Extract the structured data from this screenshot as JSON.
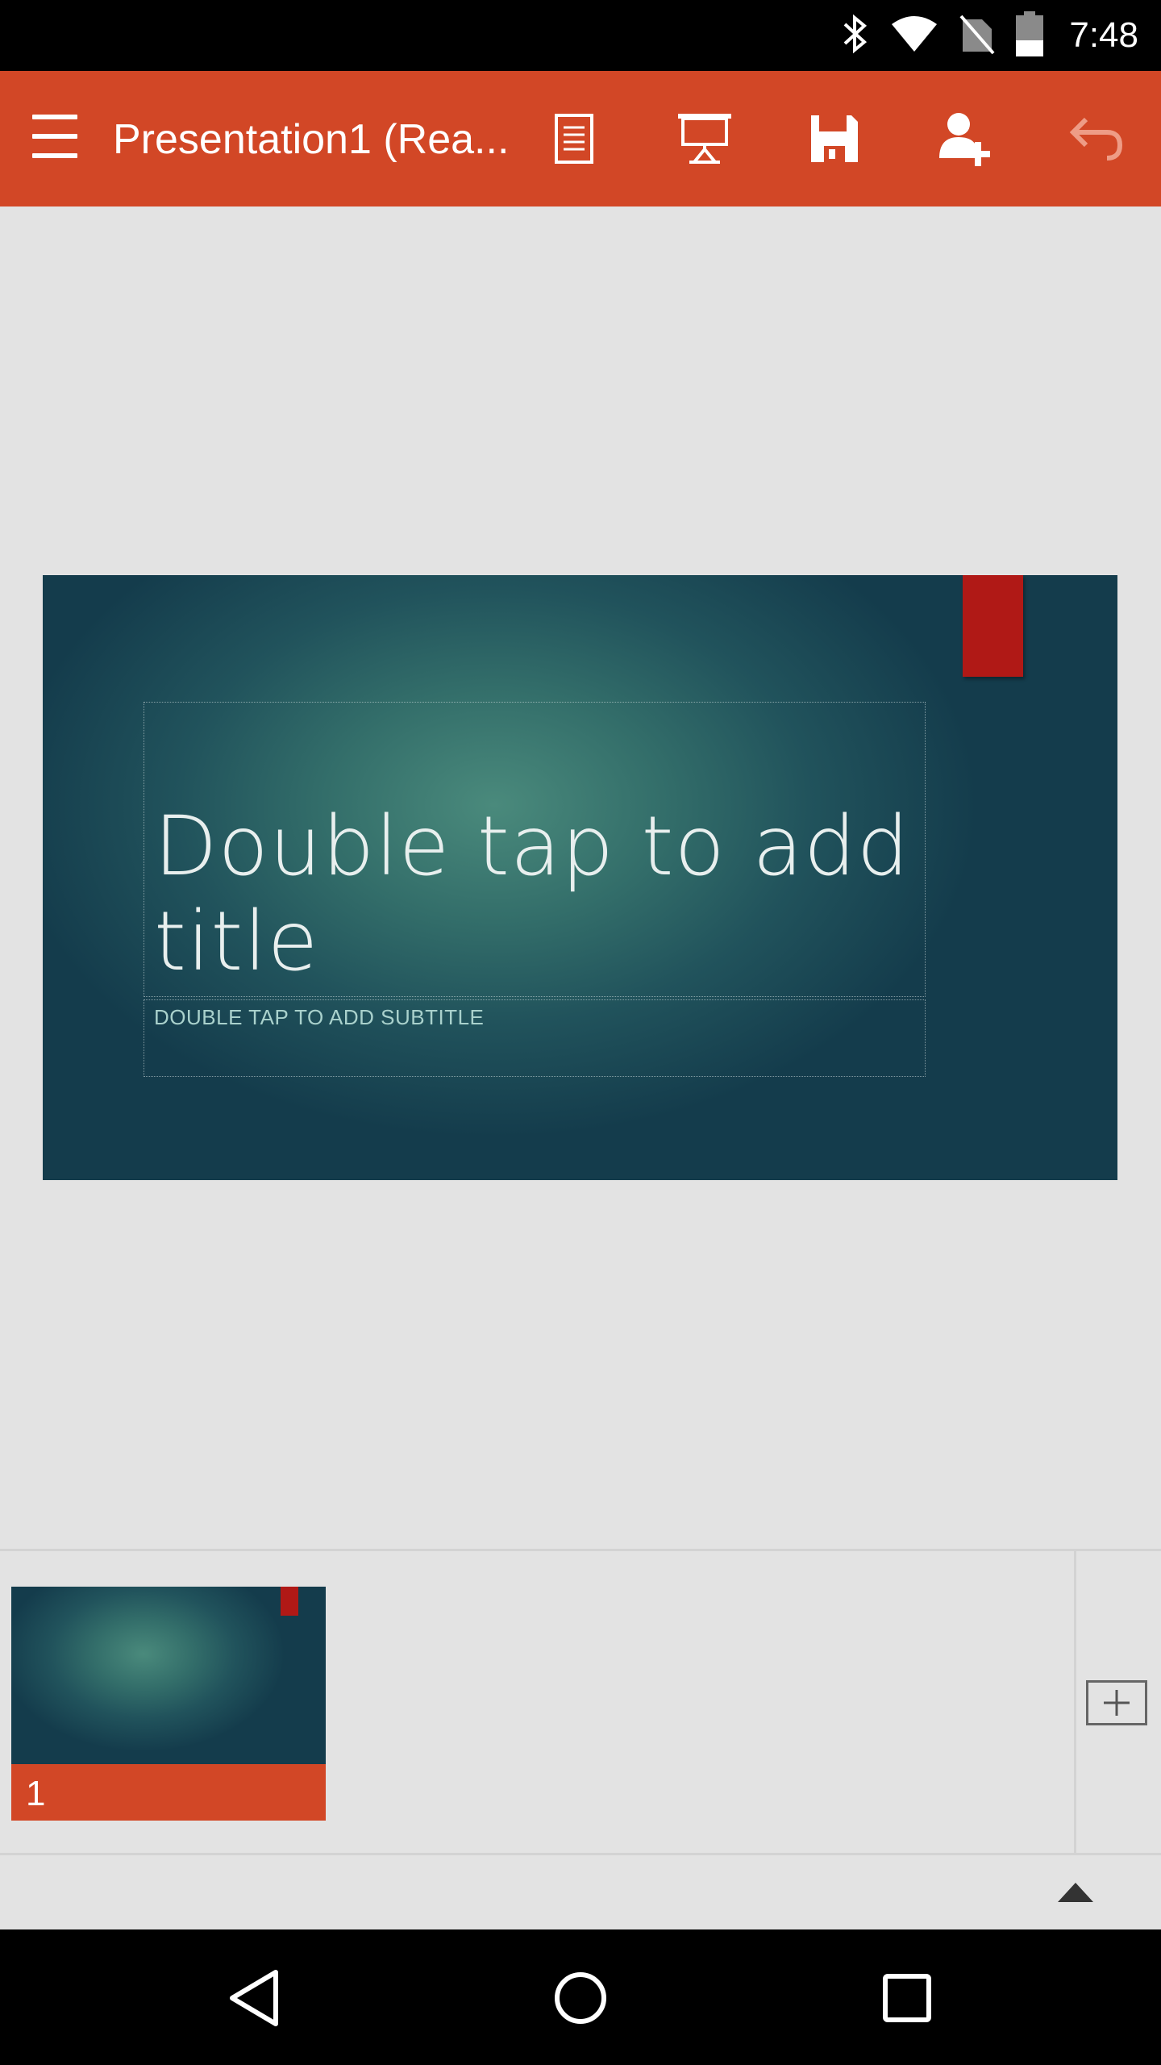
{
  "status_bar": {
    "time": "7:48",
    "icons": [
      "bluetooth-icon",
      "wifi-icon",
      "no-sim-icon",
      "battery-icon"
    ]
  },
  "app_bar": {
    "title": "Presentation1 (Rea...",
    "color": "#d24726",
    "actions": [
      "notes-icon",
      "present-icon",
      "save-icon",
      "share-person-icon",
      "undo-icon"
    ]
  },
  "slide": {
    "title_placeholder": "Double tap to add title",
    "subtitle_placeholder": "DOUBLE TAP TO ADD SUBTITLE",
    "accent_color": "#b01916"
  },
  "thumbnails": [
    {
      "number": "1"
    }
  ],
  "navigation": [
    "back-icon",
    "home-icon",
    "recents-icon"
  ]
}
